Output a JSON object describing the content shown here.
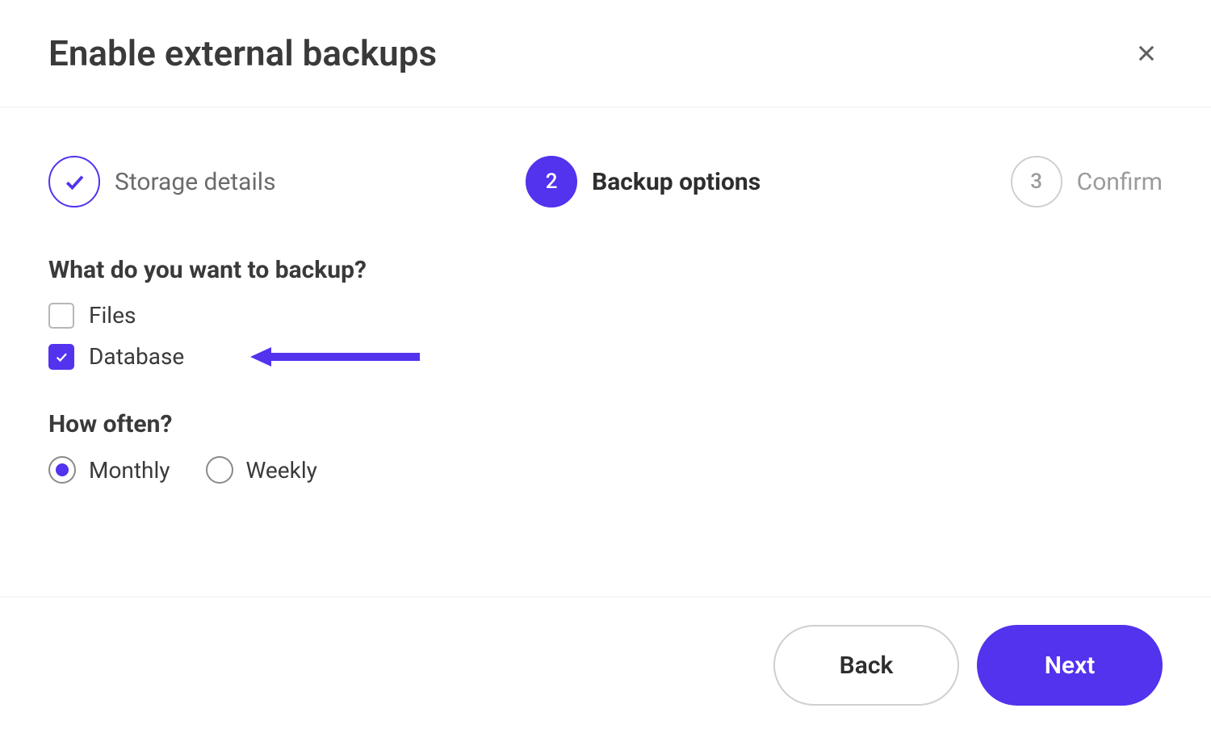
{
  "header": {
    "title": "Enable external backups"
  },
  "stepper": {
    "step1": {
      "label": "Storage details"
    },
    "step2": {
      "number": "2",
      "label": "Backup options"
    },
    "step3": {
      "number": "3",
      "label": "Confirm"
    }
  },
  "section_what": {
    "title": "What do you want to backup?",
    "files_label": "Files",
    "database_label": "Database",
    "files_checked": false,
    "database_checked": true
  },
  "section_freq": {
    "title": "How often?",
    "monthly_label": "Monthly",
    "weekly_label": "Weekly",
    "selected": "monthly"
  },
  "footer": {
    "back_label": "Back",
    "next_label": "Next"
  },
  "colors": {
    "accent": "#5333ed"
  }
}
